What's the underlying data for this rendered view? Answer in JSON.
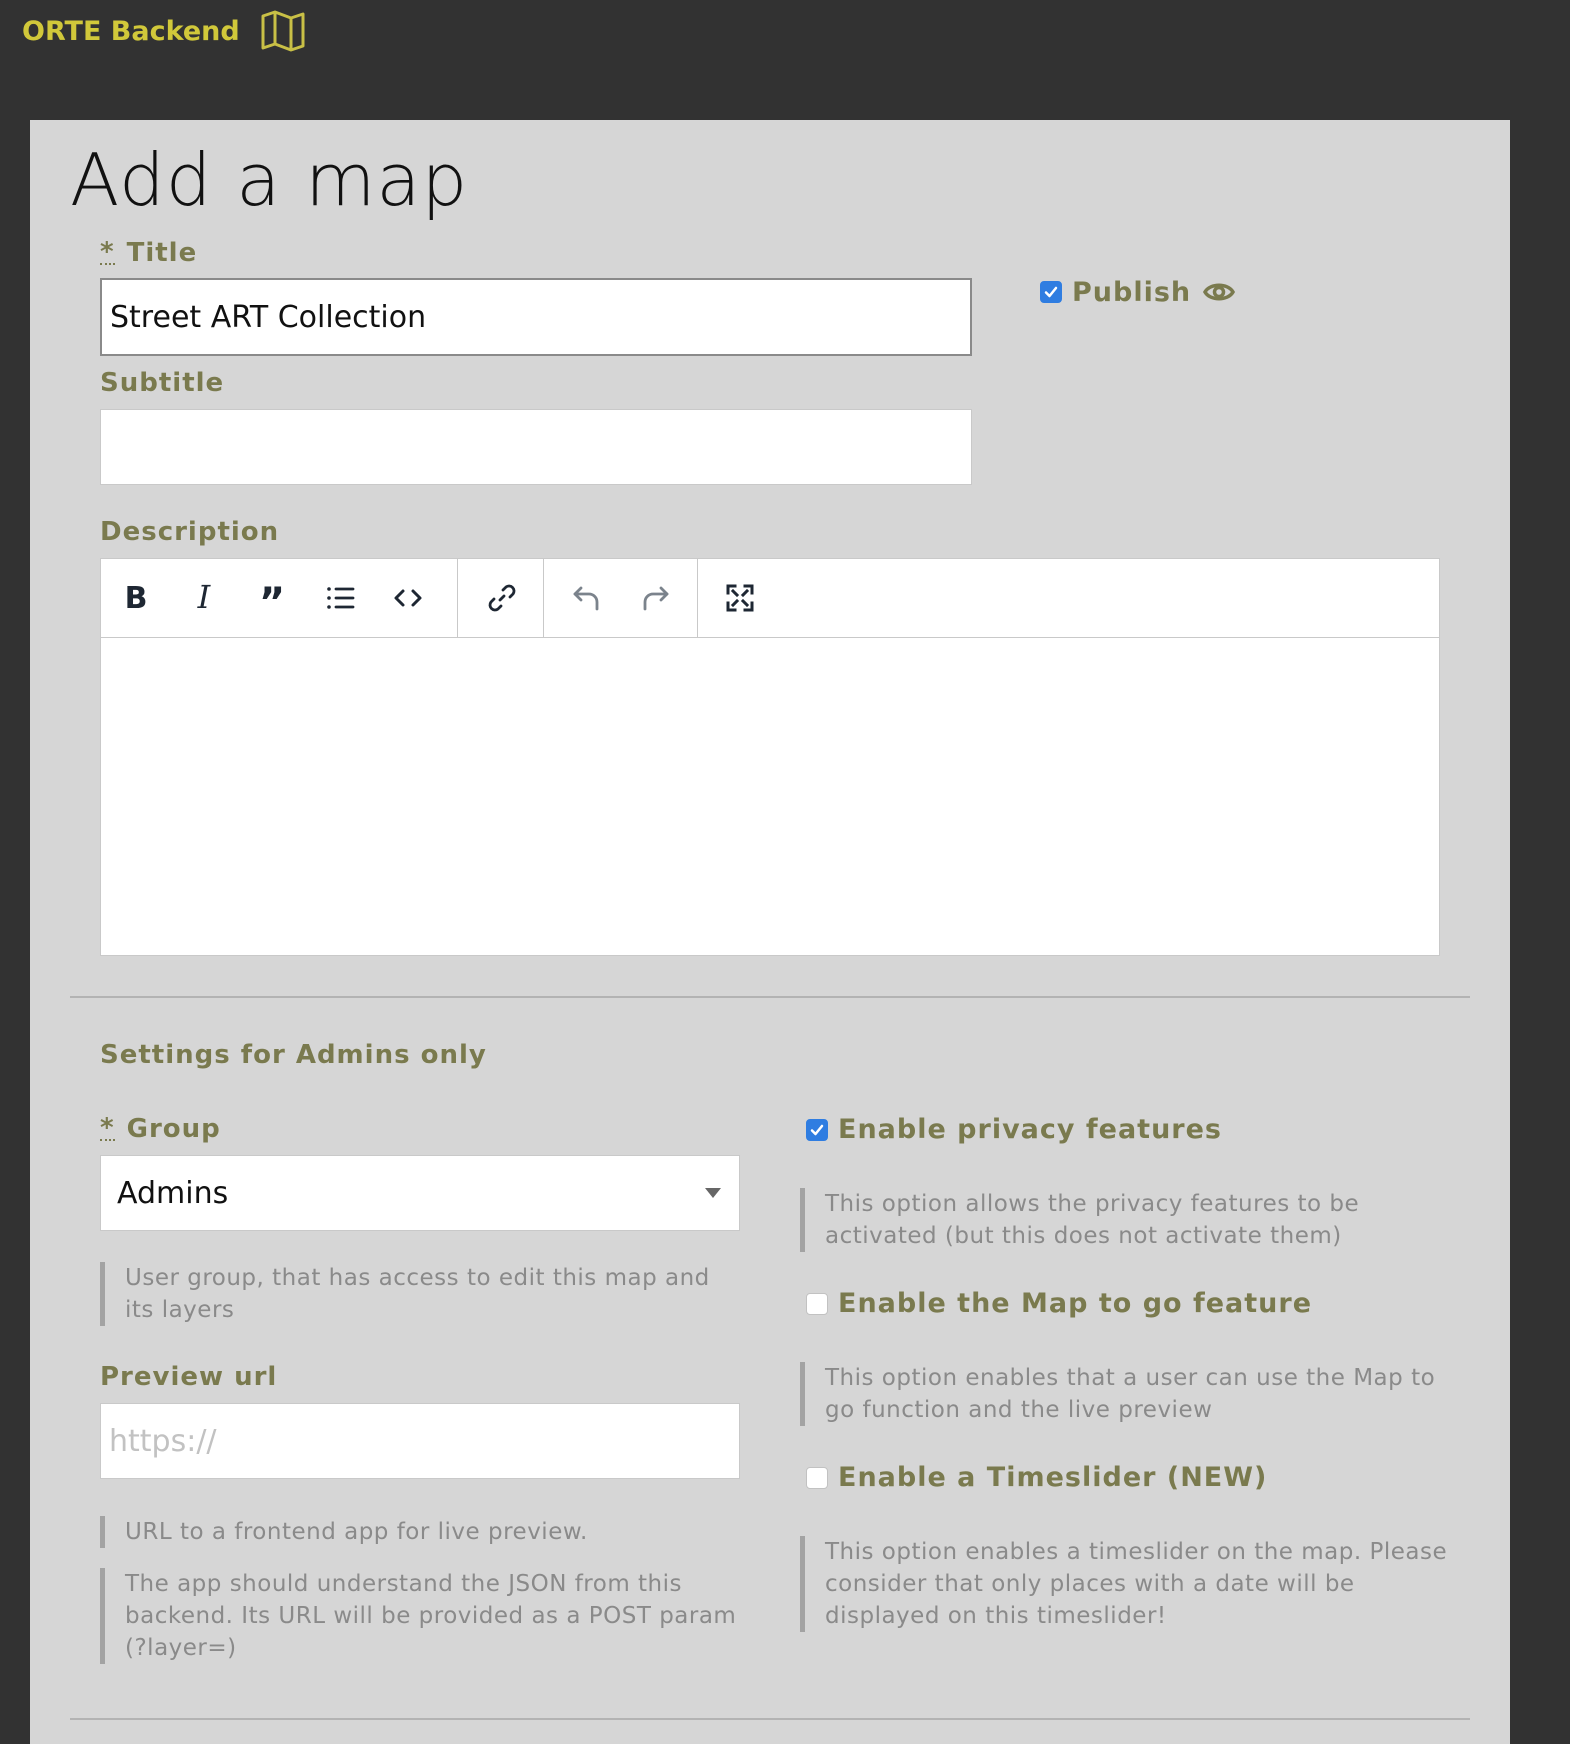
{
  "app": {
    "brand": "ORTE Backend",
    "brand_icon": "map-icon",
    "brand_color": "#d1c83a"
  },
  "page": {
    "title": "Add a map"
  },
  "form": {
    "required_mark": "*",
    "title_label": "Title",
    "title_value": "Street ART Collection",
    "publish_label": "Publish",
    "publish_checked": true,
    "subtitle_label": "Subtitle",
    "subtitle_value": "",
    "description_label": "Description",
    "toolbar": [
      "bold-icon",
      "italic-icon",
      "quote-icon",
      "list-icon",
      "code-icon",
      "link-icon",
      "undo-icon",
      "redo-icon",
      "fullscreen-icon"
    ]
  },
  "admin": {
    "heading": "Settings for Admins only",
    "group_label": "Group",
    "group_value": "Admins",
    "group_help": "User group, that has access to edit this map and its layers",
    "preview_label": "Preview url",
    "preview_placeholder": "https://",
    "preview_help_1": "URL to a frontend app for live preview.",
    "preview_help_2": "The app should understand the JSON from this backend. Its URL will be provided as a POST param (?layer=)",
    "privacy_label": "Enable privacy features",
    "privacy_checked": true,
    "privacy_help": "This option allows the privacy features to be activated (but this does not activate them)",
    "mapgo_label": "Enable the Map to go feature",
    "mapgo_checked": false,
    "mapgo_help": "This option enables that a user can use the Map to go function and the live preview",
    "timeslider_label": "Enable a Timeslider (NEW)",
    "timeslider_checked": false,
    "timeslider_help": "This option enables a timeslider on the map. Please consider that only places with a date will be displayed on this timeslider!"
  }
}
